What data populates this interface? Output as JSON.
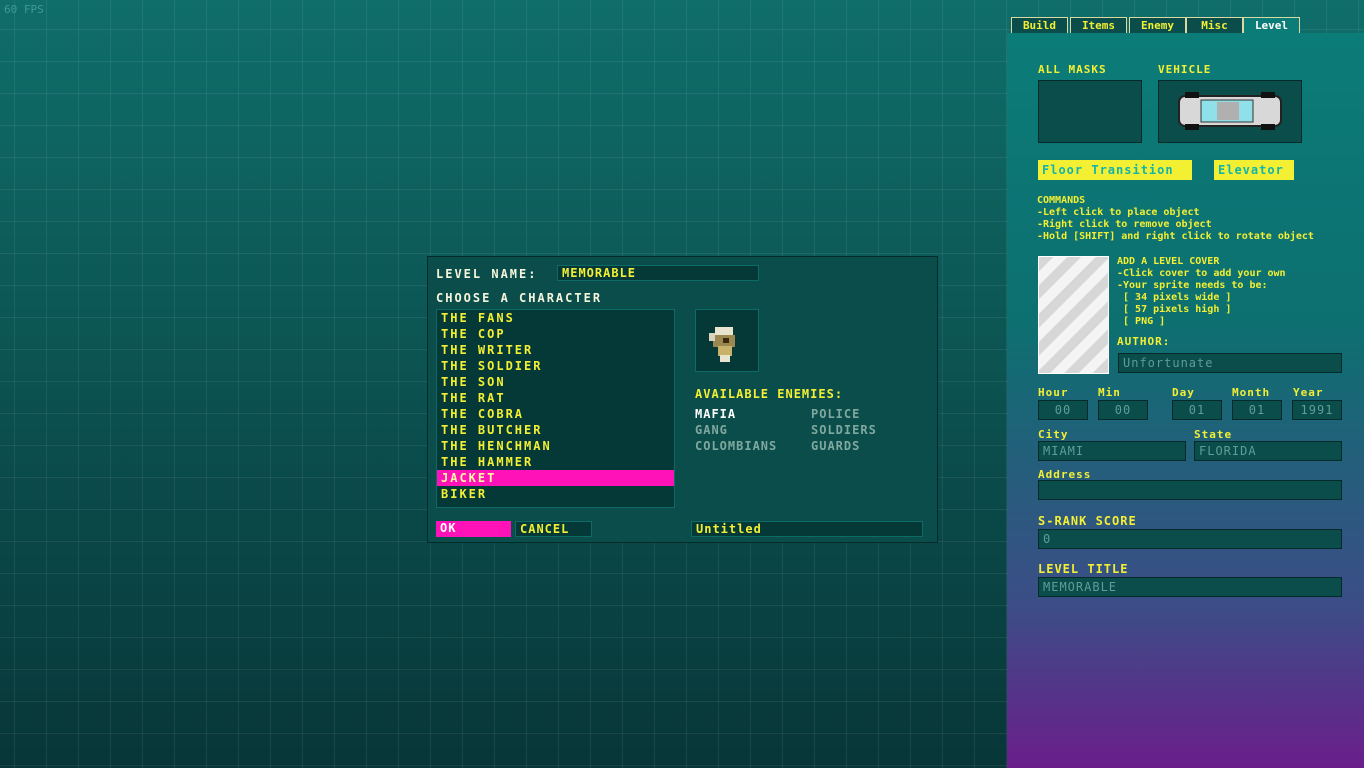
{
  "fps": "60 FPS",
  "dialog": {
    "level_name_label": "LEVEL NAME:",
    "level_name_value": "MEMORABLE",
    "choose_label": "CHOOSE A CHARACTER",
    "characters": [
      "THE FANS",
      "THE COP",
      "THE WRITER",
      "THE SOLDIER",
      "THE SON",
      "THE RAT",
      "THE COBRA",
      "THE BUTCHER",
      "THE HENCHMAN",
      "THE HAMMER",
      "JACKET",
      "BIKER"
    ],
    "selected_character": "JACKET",
    "enemies_label": "AVAILABLE ENEMIES:",
    "enemies": [
      "MAFIA",
      "POLICE",
      "GANG",
      "SOLDIERS",
      "COLOMBIANS",
      "GUARDS"
    ],
    "ok_label": "OK",
    "cancel_label": "CANCEL",
    "file_name": "Untitled",
    "colors": {
      "highlight": "#ff13b9",
      "text": "#f3ef33"
    }
  },
  "tabs": [
    "Build",
    "Items",
    "Enemy",
    "Misc",
    "Level"
  ],
  "active_tab": "Level",
  "panel": {
    "all_masks_label": "ALL MASKS",
    "vehicle_label": "VEHICLE",
    "floor_transition_label": "Floor Transition",
    "elevator_label": "Elevator",
    "commands_title": "COMMANDS",
    "commands": [
      "-Left click to place object",
      "-Right click to remove object",
      "-Hold [SHIFT] and right click to rotate object"
    ],
    "cover_title": "ADD A LEVEL COVER",
    "cover_lines": [
      "-Click cover to add your own",
      "-Your sprite needs to be:",
      " [ 34 pixels wide ]",
      " [ 57 pixels high ]",
      " [ PNG ]"
    ],
    "author_label": "AUTHOR:",
    "author_value": "Unfortunate",
    "hour_label": "Hour",
    "hour_value": "00",
    "min_label": "Min",
    "min_value": "00",
    "day_label": "Day",
    "day_value": "01",
    "month_label": "Month",
    "month_value": "01",
    "year_label": "Year",
    "year_value": "1991",
    "city_label": "City",
    "city_value": "MIAMI",
    "state_label": "State",
    "state_value": "FLORIDA",
    "address_label": "Address",
    "address_value": "",
    "srank_label": "S-RANK SCORE",
    "srank_value": "0",
    "level_title_label": "LEVEL TITLE",
    "level_title_value": "MEMORABLE"
  }
}
